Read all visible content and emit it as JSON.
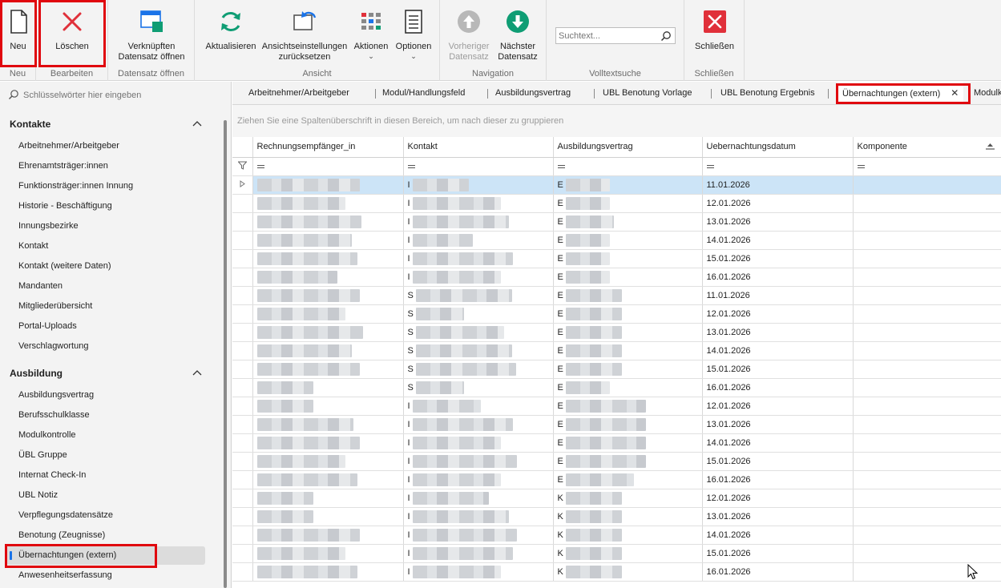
{
  "ribbon": {
    "groups": [
      {
        "label": "Neu",
        "buttons": [
          {
            "label": "Neu",
            "icon": "new-document-icon"
          }
        ]
      },
      {
        "label": "Bearbeiten",
        "buttons": [
          {
            "label": "Löschen",
            "icon": "delete-x-icon"
          }
        ]
      },
      {
        "label": "Datensatz öffnen",
        "buttons": [
          {
            "label_line1": "Verknüpften",
            "label_line2": "Datensatz öffnen",
            "icon": "linked-record-icon"
          }
        ]
      },
      {
        "label": "Ansicht",
        "buttons": [
          {
            "label": "Aktualisieren",
            "icon": "refresh-icon"
          },
          {
            "label_line1": "Ansichtseinstellungen",
            "label_line2": "zurücksetzen",
            "icon": "reset-view-icon"
          },
          {
            "label": "Aktionen",
            "icon": "actions-grid-icon"
          },
          {
            "label": "Optionen",
            "icon": "options-list-icon"
          }
        ]
      },
      {
        "label": "Navigation",
        "buttons": [
          {
            "label_line1": "Vorheriger",
            "label_line2": "Datensatz",
            "icon": "arrow-up-icon",
            "disabled": true
          },
          {
            "label_line1": "Nächster",
            "label_line2": "Datensatz",
            "icon": "arrow-down-icon"
          }
        ]
      },
      {
        "label": "Volltextsuche",
        "search_placeholder": "Suchtext..."
      },
      {
        "label": "Schließen",
        "buttons": [
          {
            "label": "Schließen",
            "icon": "close-x-icon"
          }
        ]
      }
    ]
  },
  "sidebar": {
    "search_placeholder": "Schlüsselwörter hier eingeben",
    "sections": [
      {
        "title": "Kontakte",
        "items": [
          "Arbeitnehmer/Arbeitgeber",
          "Ehrenamtsträger:innen",
          "Funktionsträger:innen Innung",
          "Historie - Beschäftigung",
          "Innungsbezirke",
          "Kontakt",
          "Kontakt (weitere Daten)",
          "Mandanten",
          "Mitgliederübersicht",
          "Portal-Uploads",
          "Verschlagwortung"
        ]
      },
      {
        "title": "Ausbildung",
        "items": [
          "Ausbildungsvertrag",
          "Berufsschulklasse",
          "Modulkontrolle",
          "ÜBL Gruppe",
          "Internat Check-In",
          "UBL Notiz",
          "Verpflegungsdatensätze",
          "Benotung (Zeugnisse)",
          "Übernachtungen (extern)",
          "Anwesenheitserfassung"
        ]
      }
    ],
    "active_item": "Übernachtungen (extern)"
  },
  "tabs": [
    "Arbeitnehmer/Arbeitgeber",
    "Modul/Handlungsfeld",
    "Ausbildungsvertrag",
    "UBL Benotung Vorlage",
    "UBL Benotung Ergebnis",
    "Übernachtungen (extern)",
    "Modulk"
  ],
  "active_tab": "Übernachtungen (extern)",
  "grid": {
    "group_hint": "Ziehen Sie eine Spaltenüberschrift in diesen Bereich, um nach dieser zu gruppieren",
    "columns": [
      "Rechnungsempfänger_in",
      "Kontakt",
      "Ausbildungsvertrag",
      "Uebernachtungsdatum",
      "Komponente"
    ],
    "rows": [
      {
        "kontakt_initial": "I",
        "vertrag_initial": "E",
        "datum": "11.01.2026"
      },
      {
        "kontakt_initial": "I",
        "vertrag_initial": "E",
        "datum": "12.01.2026"
      },
      {
        "kontakt_initial": "I",
        "vertrag_initial": "E",
        "datum": "13.01.2026"
      },
      {
        "kontakt_initial": "I",
        "vertrag_initial": "E",
        "datum": "14.01.2026"
      },
      {
        "kontakt_initial": "I",
        "vertrag_initial": "E",
        "datum": "15.01.2026"
      },
      {
        "kontakt_initial": "I",
        "vertrag_initial": "E",
        "datum": "16.01.2026"
      },
      {
        "kontakt_initial": "S",
        "vertrag_initial": "E",
        "datum": "11.01.2026"
      },
      {
        "kontakt_initial": "S",
        "vertrag_initial": "E",
        "datum": "12.01.2026"
      },
      {
        "kontakt_initial": "S",
        "vertrag_initial": "E",
        "datum": "13.01.2026"
      },
      {
        "kontakt_initial": "S",
        "vertrag_initial": "E",
        "datum": "14.01.2026"
      },
      {
        "kontakt_initial": "S",
        "vertrag_initial": "E",
        "datum": "15.01.2026"
      },
      {
        "kontakt_initial": "S",
        "vertrag_initial": "E",
        "datum": "16.01.2026"
      },
      {
        "kontakt_initial": "I",
        "vertrag_initial": "E",
        "datum": "12.01.2026"
      },
      {
        "kontakt_initial": "I",
        "vertrag_initial": "E",
        "datum": "13.01.2026"
      },
      {
        "kontakt_initial": "I",
        "vertrag_initial": "E",
        "datum": "14.01.2026"
      },
      {
        "kontakt_initial": "I",
        "vertrag_initial": "E",
        "datum": "15.01.2026"
      },
      {
        "kontakt_initial": "I",
        "vertrag_initial": "E",
        "datum": "16.01.2026"
      },
      {
        "kontakt_initial": "I",
        "vertrag_initial": "K",
        "datum": "12.01.2026"
      },
      {
        "kontakt_initial": "I",
        "vertrag_initial": "K",
        "datum": "13.01.2026"
      },
      {
        "kontakt_initial": "I",
        "vertrag_initial": "K",
        "datum": "14.01.2026"
      },
      {
        "kontakt_initial": "I",
        "vertrag_initial": "K",
        "datum": "15.01.2026"
      },
      {
        "kontakt_initial": "I",
        "vertrag_initial": "K",
        "datum": "16.01.2026"
      }
    ],
    "selected_row": 0
  },
  "colors": {
    "highlight_box": "#e0070e",
    "accent": "#1a73e8",
    "selected_row": "#cce4f7",
    "teal": "#0f9d74",
    "delete_red": "#e0303a"
  }
}
